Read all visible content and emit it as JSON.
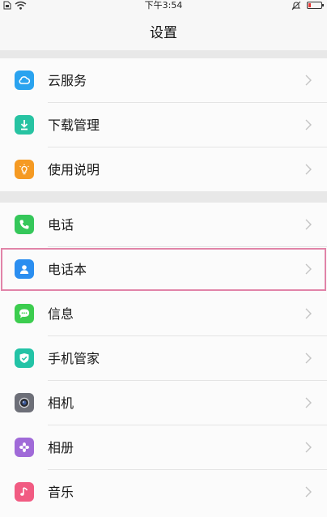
{
  "status_bar": {
    "time": "下午3:54",
    "icons": [
      "sim-icon",
      "wifi-icon",
      "bell-muted-icon",
      "battery-low-icon"
    ],
    "battery_color": "#e53935"
  },
  "nav": {
    "title": "设置"
  },
  "groups": [
    {
      "items": [
        {
          "label": "云服务",
          "icon": "cloud-icon",
          "color": "#2aa3ef"
        },
        {
          "label": "下载管理",
          "icon": "download-icon",
          "color": "#27c3a2"
        },
        {
          "label": "使用说明",
          "icon": "bulb-icon",
          "color": "#f59a23"
        }
      ]
    },
    {
      "items": [
        {
          "label": "电话",
          "icon": "phone-icon",
          "color": "#35c75a"
        },
        {
          "label": "电话本",
          "icon": "contacts-icon",
          "color": "#2b8ef0",
          "highlighted": true
        },
        {
          "label": "信息",
          "icon": "message-icon",
          "color": "#3ccd4f"
        },
        {
          "label": "手机管家",
          "icon": "shield-icon",
          "color": "#23c3a6"
        },
        {
          "label": "相机",
          "icon": "camera-icon",
          "color": "#6d6f78"
        },
        {
          "label": "相册",
          "icon": "flower-icon",
          "color": "#a06ad8"
        },
        {
          "label": "音乐",
          "icon": "music-icon",
          "color": "#f15b82"
        }
      ]
    }
  ]
}
